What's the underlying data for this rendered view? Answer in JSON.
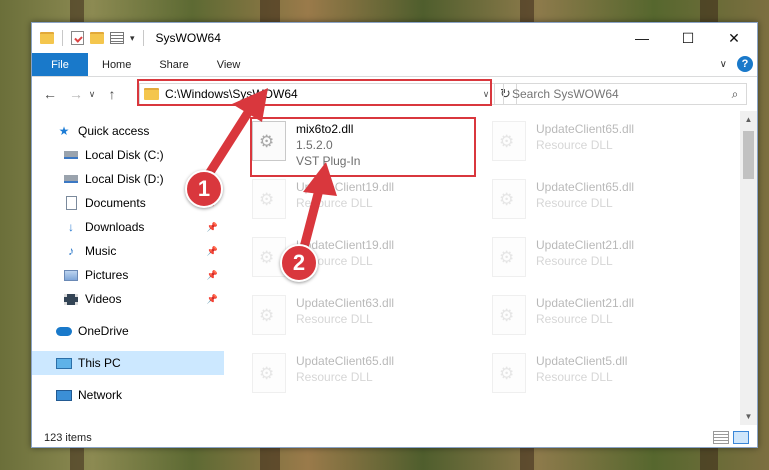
{
  "window": {
    "title": "SysWOW64"
  },
  "title_controls": {
    "minimize": "—",
    "maximize": "☐",
    "close": "✕"
  },
  "ribbon": {
    "tabs": [
      {
        "label": "File"
      },
      {
        "label": "Home"
      },
      {
        "label": "Share"
      },
      {
        "label": "View"
      }
    ],
    "expand_glyph": "∨",
    "help_glyph": "?"
  },
  "nav": {
    "back": "←",
    "forward": "→",
    "recent": "∨",
    "up": "↑",
    "address": "C:\\Windows\\SysWOW64",
    "address_drop": "∨",
    "refresh": "↻",
    "search_placeholder": "Search SysWOW64",
    "search_glyph": "⌕"
  },
  "sidebar": {
    "items": [
      {
        "label": "Quick access",
        "icon": "star-icon",
        "glyph": "★"
      },
      {
        "label": "Local Disk (C:)",
        "icon": "drive-icon"
      },
      {
        "label": "Local Disk (D:)",
        "icon": "drive-icon"
      },
      {
        "label": "Documents",
        "icon": "documents-icon",
        "pin": "📌"
      },
      {
        "label": "Downloads",
        "icon": "download-icon",
        "glyph": "↓",
        "pin": "📌"
      },
      {
        "label": "Music",
        "icon": "music-icon",
        "glyph": "♪",
        "pin": "📌"
      },
      {
        "label": "Pictures",
        "icon": "pictures-icon",
        "pin": "📌"
      },
      {
        "label": "Videos",
        "icon": "videos-icon",
        "pin": "📌"
      },
      {
        "label": "OneDrive",
        "icon": "onedrive-icon"
      },
      {
        "label": "This PC",
        "icon": "this-pc-icon"
      },
      {
        "label": "Network",
        "icon": "network-icon"
      }
    ]
  },
  "files": [
    {
      "name": "mix6to2.dll",
      "line2": "1.5.2.0",
      "line3": "VST Plug-In"
    },
    {
      "name": "UpdateClient65.dll",
      "line2": "Resource DLL"
    },
    {
      "name": "UpdateClient19.dll",
      "line2": "Resource DLL"
    },
    {
      "name": "UpdateClient65.dll",
      "line2": "Resource DLL"
    },
    {
      "name": "UpdateClient19.dll",
      "line2": "Resource DLL"
    },
    {
      "name": "UpdateClient21.dll",
      "line2": "Resource DLL"
    },
    {
      "name": "UpdateClient63.dll",
      "line2": "Resource DLL"
    },
    {
      "name": "UpdateClient21.dll",
      "line2": "Resource DLL"
    },
    {
      "name": "UpdateClient65.dll",
      "line2": "Resource DLL"
    },
    {
      "name": "UpdateClient5.dll",
      "line2": "Resource DLL"
    }
  ],
  "scrollbar": {
    "up": "▲",
    "down": "▼"
  },
  "status": {
    "item_count": "123 items"
  },
  "annotations": {
    "step1": "1",
    "step2": "2",
    "color": "#d9373d"
  }
}
